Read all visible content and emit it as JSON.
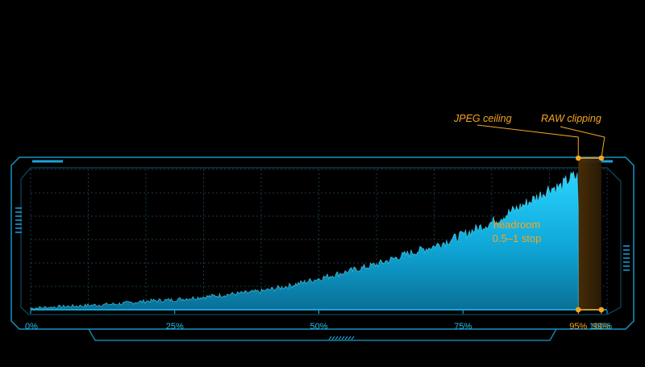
{
  "chart_data": {
    "type": "area",
    "title": "",
    "xlabel": "",
    "ylabel": "",
    "x_ticks": [
      "0%",
      "25%",
      "50%",
      "75%",
      "95%",
      "99%",
      "100%"
    ],
    "x_tick_values": [
      0,
      25,
      50,
      75,
      95,
      99,
      100
    ],
    "xlim": [
      0,
      100
    ],
    "ylim": [
      0,
      1
    ],
    "grid": true,
    "series": [
      {
        "x": [
          0,
          5,
          10,
          15,
          20,
          25,
          30,
          35,
          40,
          45,
          50,
          55,
          60,
          65,
          70,
          75,
          80,
          85,
          88,
          90,
          92,
          93,
          94,
          95
        ],
        "values": [
          0.01,
          0.02,
          0.03,
          0.04,
          0.06,
          0.07,
          0.09,
          0.11,
          0.13,
          0.17,
          0.22,
          0.27,
          0.32,
          0.39,
          0.45,
          0.53,
          0.62,
          0.73,
          0.8,
          0.86,
          0.87,
          0.91,
          0.94,
          0.94
        ]
      }
    ],
    "annotations": {
      "jpeg": {
        "label": "JPEG ceiling",
        "x": 95
      },
      "raw": {
        "label": "RAW clipping",
        "x": 99
      },
      "headroom": {
        "line1": "headroom",
        "line2": "0.5–1 stop"
      }
    },
    "colors": {
      "accent": "#21c2f0",
      "frame": "#1aa3d6",
      "grid": "#163c4a",
      "annotation": "#f5a623"
    }
  }
}
